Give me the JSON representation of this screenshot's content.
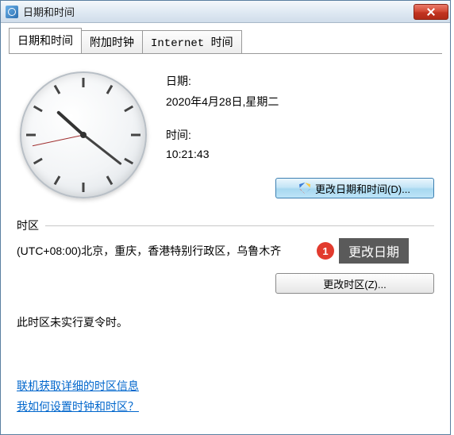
{
  "window": {
    "title": "日期和时间"
  },
  "tabs": [
    {
      "label": "日期和时间",
      "active": true
    },
    {
      "label": "附加时钟",
      "active": false
    },
    {
      "label": "Internet 时间",
      "active": false
    }
  ],
  "date": {
    "label": "日期:",
    "value": "2020年4月28日,星期二"
  },
  "time": {
    "label": "时间:",
    "value": "10:21:43"
  },
  "buttons": {
    "change_datetime": "更改日期和时间(D)...",
    "change_timezone": "更改时区(Z)..."
  },
  "timezone": {
    "section_label": "时区",
    "value": "(UTC+08:00)北京，重庆，香港特别行政区，乌鲁木齐",
    "dst_note": "此时区未实行夏令时。"
  },
  "links": {
    "tz_details": "联机获取详细的时区信息",
    "how_to": "我如何设置时钟和时区？"
  },
  "callout": {
    "num": "1",
    "text": "更改日期"
  }
}
